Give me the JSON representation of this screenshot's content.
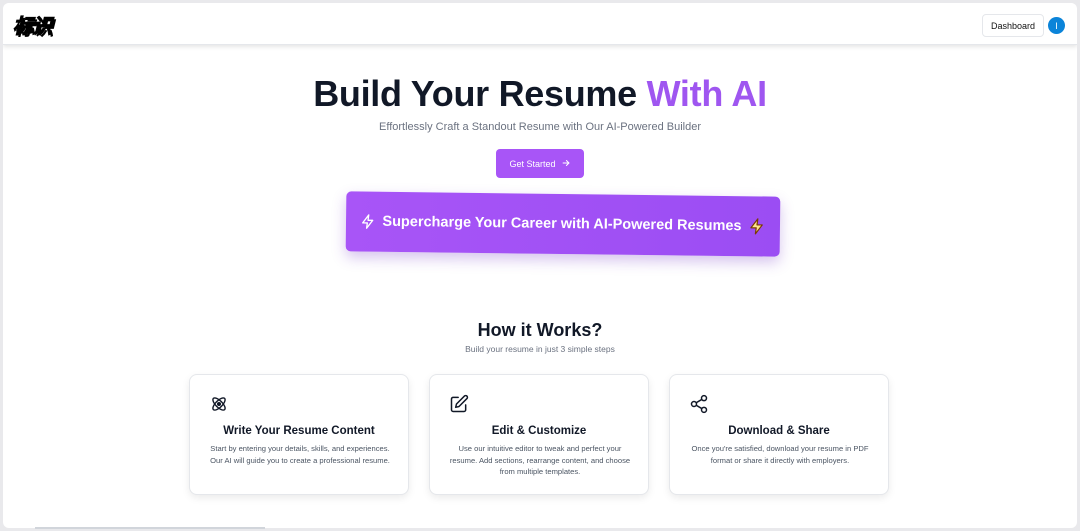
{
  "header": {
    "logo_text": "标识",
    "dashboard_label": "Dashboard",
    "avatar_initial": "I"
  },
  "hero": {
    "title_main": "Build Your Resume",
    "title_accent": "With AI",
    "subtitle": "Effortlessly Craft a Standout Resume with Our AI-Powered Builder",
    "cta_label": "Get Started",
    "banner_text": "Supercharge Your Career with AI-Powered Resumes"
  },
  "how": {
    "title": "How it Works?",
    "subtitle": "Build your resume in just 3 simple steps",
    "cards": [
      {
        "icon": "atom-icon",
        "title": "Write Your Resume Content",
        "desc": "Start by entering your details, skills, and experiences. Our AI will guide you to create a professional resume."
      },
      {
        "icon": "edit-icon",
        "title": "Edit & Customize",
        "desc": "Use our intuitive editor to tweak and perfect your resume. Add sections, rearrange content, and choose from multiple templates."
      },
      {
        "icon": "share-icon",
        "title": "Download & Share",
        "desc": "Once you're satisfied, download your resume in PDF format or share it directly with employers."
      }
    ]
  },
  "colors": {
    "accent": "#a855f7",
    "accent_text": "#9f56f0",
    "avatar": "#0b84d9"
  }
}
